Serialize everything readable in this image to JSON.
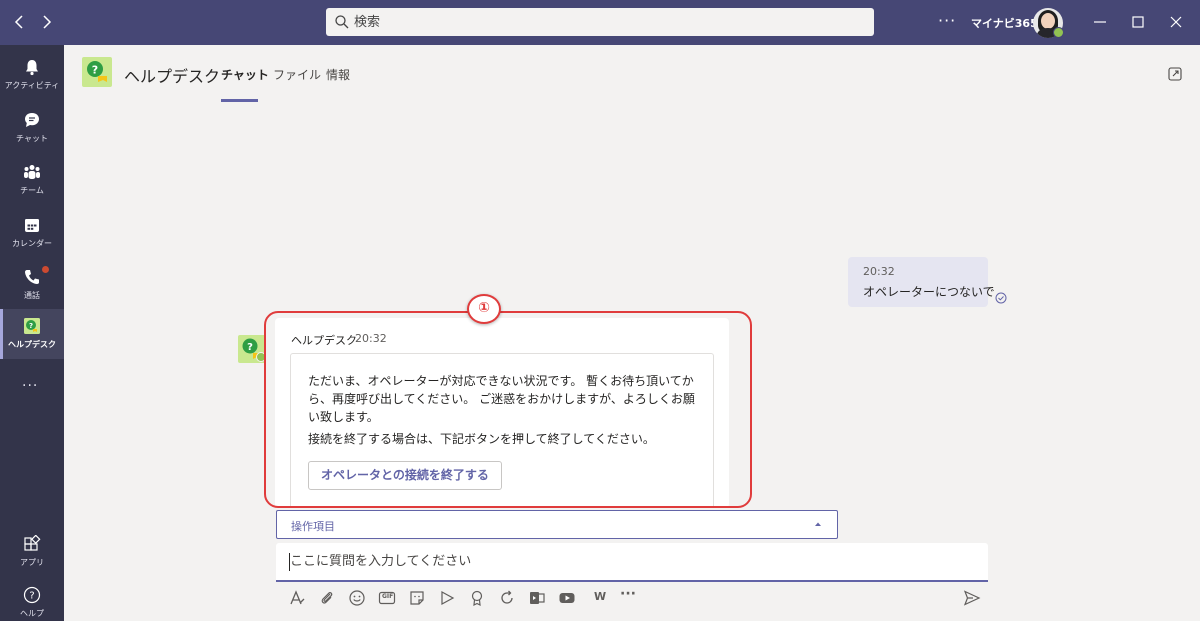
{
  "titlebar": {
    "search_placeholder": "検索",
    "org_name": "マイナビ365",
    "more_label": "···"
  },
  "rail": {
    "items": [
      {
        "label": "アクティビティ",
        "icon": "bell-icon"
      },
      {
        "label": "チャット",
        "icon": "chat-icon"
      },
      {
        "label": "チーム",
        "icon": "teams-icon"
      },
      {
        "label": "カレンダー",
        "icon": "calendar-icon"
      },
      {
        "label": "通話",
        "icon": "phone-icon"
      },
      {
        "label": "ヘルプデスク",
        "icon": "helpdesk-app-icon"
      }
    ],
    "more_label": "···",
    "bottom_items": [
      {
        "label": "アプリ",
        "icon": "apps-icon"
      },
      {
        "label": "ヘルプ",
        "icon": "help-icon"
      }
    ]
  },
  "header": {
    "app_name": "ヘルプデスク",
    "tabs": [
      {
        "label": "チャット",
        "active": true
      },
      {
        "label": "ファイル",
        "active": false
      },
      {
        "label": "情報",
        "active": false
      }
    ]
  },
  "sent_message": {
    "time": "20:32",
    "text": "オペレーターにつないで"
  },
  "bot_message": {
    "sender": "ヘルプデスク",
    "time": "20:32",
    "paragraph1": "ただいま、オペレーターが対応できない状況です。 暫くお待ち頂いてから、再度呼び出してください。 ご迷惑をおかけしますが、よろしくお願い致します。",
    "paragraph2": "接続を終了する場合は、下記ボタンを押して終了してください。",
    "button_label": "オペレータとの接続を終了する"
  },
  "annotation": {
    "label": "①",
    "color": "#e03c3c"
  },
  "actions_dropdown": {
    "label": "操作項目"
  },
  "compose": {
    "placeholder": "ここに質問を入力してください"
  },
  "toolbar": {
    "gif_label": "GIF",
    "wiki_label": "W",
    "more_label": "···"
  },
  "colors": {
    "titlebar": "#464775",
    "rail": "#33344a",
    "accent": "#6264a7",
    "background": "#f3f2f1",
    "presence": "#92c353"
  }
}
